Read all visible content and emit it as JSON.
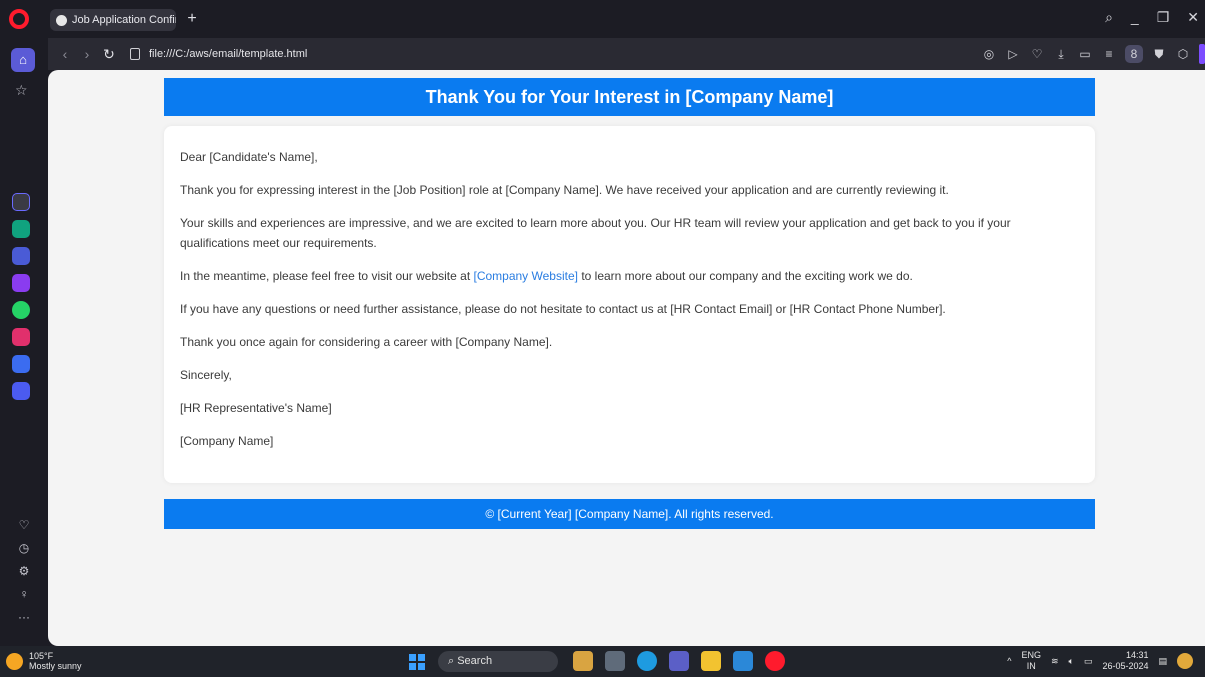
{
  "browser": {
    "tab_title": "Job Application Confirmat",
    "url": "file:///C:/aws/email/template.html"
  },
  "email": {
    "header_title": "Thank You for Your Interest in [Company Name]",
    "greeting": "Dear [Candidate's Name],",
    "p1": "Thank you for expressing interest in the [Job Position] role at [Company Name]. We have received your application and are currently reviewing it.",
    "p2": "Your skills and experiences are impressive, and we are excited to learn more about you. Our HR team will review your application and get back to you if your qualifications meet our requirements.",
    "p3_before": "In the meantime, please feel free to visit our website at ",
    "p3_link": "[Company Website]",
    "p3_after": " to learn more about our company and the exciting work we do.",
    "p4": "If you have any questions or need further assistance, please do not hesitate to contact us at [HR Contact Email] or [HR Contact Phone Number].",
    "p5": "Thank you once again for considering a career with [Company Name].",
    "closing": "Sincerely,",
    "signer": "[HR Representative's Name]",
    "company": "[Company Name]",
    "footer": "© [Current Year] [Company Name]. All rights reserved."
  },
  "taskbar": {
    "temperature": "105°F",
    "weather": "Mostly sunny",
    "search_label": "Search",
    "lang_top": "ENG",
    "lang_bottom": "IN",
    "time": "14:31",
    "date": "26-05-2024"
  },
  "colors": {
    "accent": "#0a7bf0",
    "link": "#2a7de1",
    "opera_red": "#ff1b2d"
  }
}
